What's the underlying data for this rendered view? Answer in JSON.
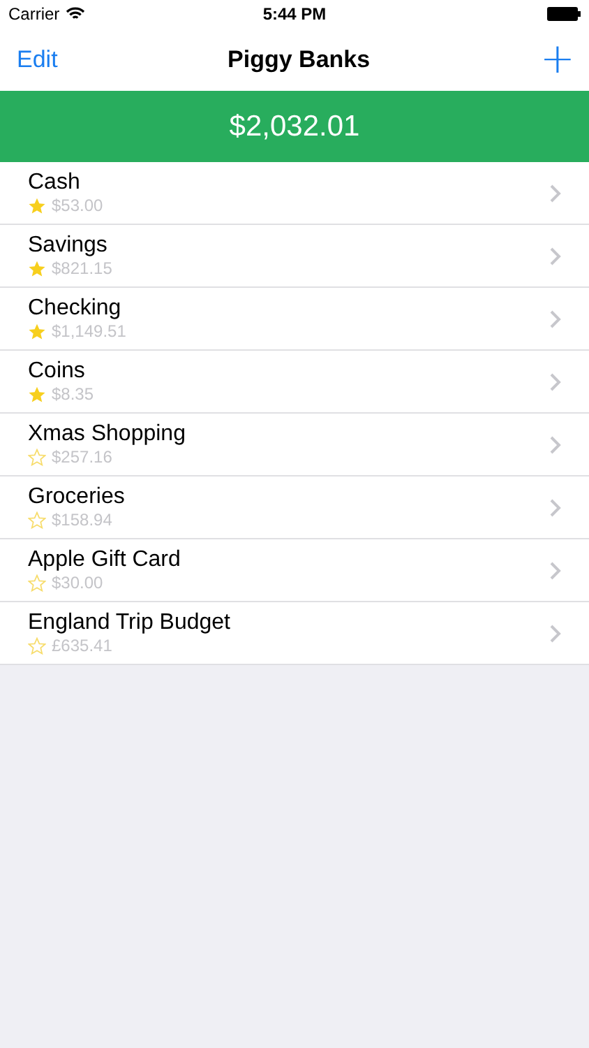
{
  "status_bar": {
    "carrier": "Carrier",
    "time": "5:44 PM"
  },
  "nav": {
    "left": "Edit",
    "title": "Piggy Banks",
    "right": "+"
  },
  "total": "$2,032.01",
  "banks": [
    {
      "name": "Cash",
      "amount": "$53.00",
      "starred": true
    },
    {
      "name": "Savings",
      "amount": "$821.15",
      "starred": true
    },
    {
      "name": "Checking",
      "amount": "$1,149.51",
      "starred": true
    },
    {
      "name": "Coins",
      "amount": "$8.35",
      "starred": true
    },
    {
      "name": "Xmas Shopping",
      "amount": "$257.16",
      "starred": false
    },
    {
      "name": "Groceries",
      "amount": "$158.94",
      "starred": false
    },
    {
      "name": "Apple Gift Card",
      "amount": "$30.00",
      "starred": false
    },
    {
      "name": "England Trip Budget",
      "amount": "£635.41",
      "starred": false
    }
  ]
}
